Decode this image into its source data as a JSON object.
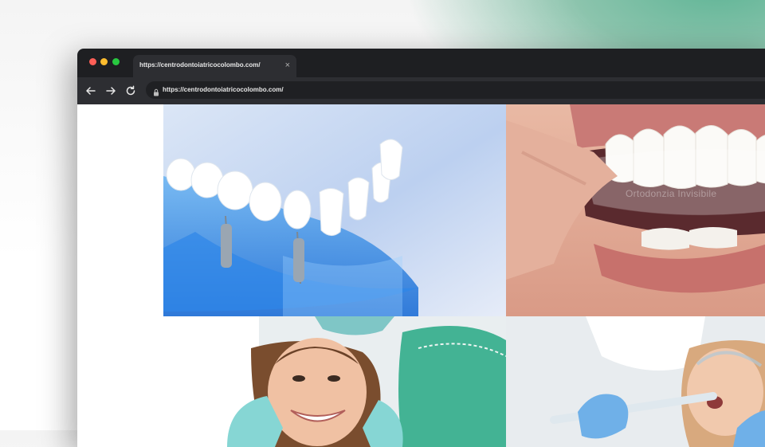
{
  "browser": {
    "tab": {
      "title": "https://centrodontoiatricocolombo.com/",
      "close_symbol": "×"
    },
    "address_bar": {
      "url": "https://centrodontoiatricocolombo.com/"
    },
    "icons": [
      "back-arrow-icon",
      "forward-arrow-icon",
      "reload-icon",
      "lock-icon",
      "close-icon"
    ]
  },
  "page": {
    "gallery": [
      {
        "subject": "dental implant model"
      },
      {
        "subject": "invisible aligner",
        "overlay_text": "Ortodonzia Invisibile"
      },
      {
        "subject": "smiling patient in dental chair"
      },
      {
        "subject": "dental cleaning treatment"
      }
    ]
  },
  "colors": {
    "chrome_dark": "#1e1f22",
    "toolbar": "#2d2e32",
    "accent_green": "#5fb596"
  }
}
